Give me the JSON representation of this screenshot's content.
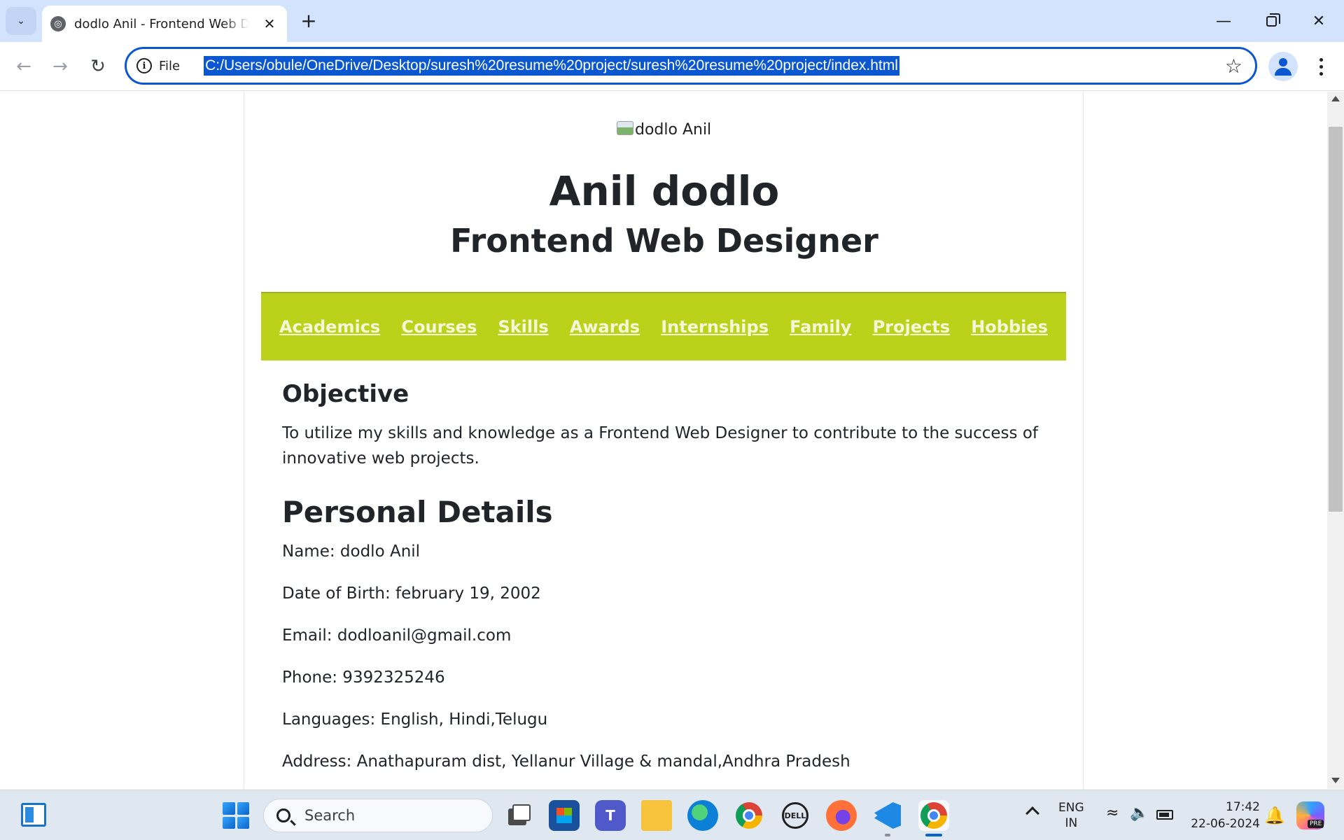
{
  "browser": {
    "tab_title": "dodlo Anil - Frontend Web Designer",
    "new_tab_symbol": "+",
    "url_scheme_label": "File",
    "url": "C:/Users/obule/OneDrive/Desktop/suresh%20resume%20project/suresh%20resume%20project/index.html",
    "icons": [
      "tab-search-icon",
      "globe-icon",
      "close-icon",
      "back-arrow-icon",
      "forward-arrow-icon",
      "reload-icon",
      "info-icon",
      "star-icon",
      "profile-icon",
      "kebab-menu-icon",
      "minimize-icon",
      "maximize-icon",
      "close-window-icon"
    ]
  },
  "resume": {
    "image_alt": "dodlo Anil",
    "name": "Anil dodlo",
    "role": "Frontend Web Designer",
    "accent_color": "#bcd21a",
    "nav": [
      {
        "label": "Academics"
      },
      {
        "label": "Courses"
      },
      {
        "label": "Skills"
      },
      {
        "label": "Awards"
      },
      {
        "label": "Internships"
      },
      {
        "label": "Family"
      },
      {
        "label": "Projects"
      },
      {
        "label": "Hobbies"
      }
    ],
    "objective": {
      "heading": "Objective",
      "text": "To utilize my skills and knowledge as a Frontend Web Designer to contribute to the success of innovative web projects."
    },
    "personal": {
      "heading": "Personal Details",
      "items": [
        "Name: dodlo Anil",
        "Date of Birth: february 19, 2002",
        "Email: dodloanil@gmail.com",
        "Phone: 9392325246",
        "Languages: English, Hindi,Telugu",
        "Address: Anathapuram dist, Yellanur Village & mandal,Andhra Pradesh"
      ]
    }
  },
  "taskbar": {
    "search_label": "Search",
    "language_line1": "ENG",
    "language_line2": "IN",
    "time": "17:42",
    "date": "22-06-2024",
    "pre_badge": "PRE",
    "dell_label": "DELL",
    "apps": [
      "widgets-icon",
      "start-icon",
      "task-view-icon",
      "microsoft-store-icon",
      "teams-icon",
      "file-explorer-icon",
      "edge-icon",
      "chrome-icon",
      "dell-icon",
      "firefox-icon",
      "vscode-icon",
      "chrome-icon"
    ]
  }
}
